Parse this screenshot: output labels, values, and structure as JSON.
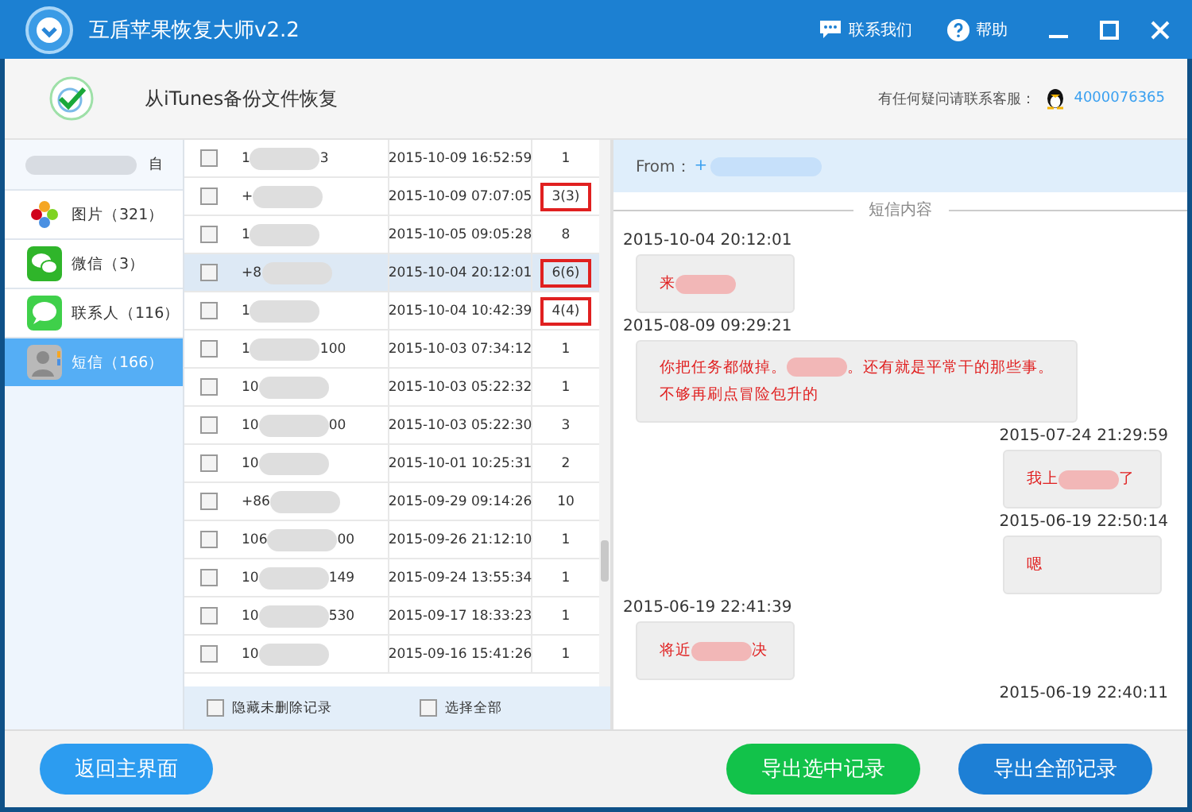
{
  "window": {
    "title": "互盾苹果恢复大师v2.2",
    "contact": "联系我们",
    "help": "帮助"
  },
  "header": {
    "title": "从iTunes备份文件恢复",
    "support_label": "有任何疑问请联系客服：",
    "support_number": "4000076365"
  },
  "sidebar": {
    "device": "自",
    "items": [
      {
        "kind": "photos",
        "label": "图片（321）",
        "selected": false
      },
      {
        "kind": "wechat",
        "label": "微信（3）",
        "selected": false
      },
      {
        "kind": "contacts",
        "label": "联系人（116）",
        "selected": false
      },
      {
        "kind": "sms",
        "label": "短信（166）",
        "selected": true
      }
    ]
  },
  "table": {
    "rows": [
      {
        "checked": false,
        "prefix": "1",
        "suffix": "3",
        "date": "2015-10-09 16:52:59",
        "count": "1",
        "selected": false,
        "flagged": false
      },
      {
        "checked": false,
        "prefix": "+",
        "date": "2015-10-09 07:07:05",
        "count": "3(3)",
        "selected": false,
        "flagged": true
      },
      {
        "checked": false,
        "prefix": "1",
        "date": "2015-10-05 09:05:28",
        "count": "8",
        "selected": false,
        "flagged": false
      },
      {
        "checked": false,
        "prefix": "+8",
        "date": "2015-10-04 20:12:01",
        "count": "6(6)",
        "selected": true,
        "flagged": true
      },
      {
        "checked": false,
        "prefix": "1",
        "date": "2015-10-04 10:42:39",
        "count": "4(4)",
        "selected": false,
        "flagged": true
      },
      {
        "checked": false,
        "prefix": "1",
        "suffix": "100",
        "date": "2015-10-03 07:34:12",
        "count": "1",
        "selected": false,
        "flagged": false
      },
      {
        "checked": false,
        "prefix": "10",
        "date": "2015-10-03 05:22:32",
        "count": "1",
        "selected": false,
        "flagged": false
      },
      {
        "checked": false,
        "prefix": "10",
        "suffix": "00",
        "date": "2015-10-03 05:22:30",
        "count": "3",
        "selected": false,
        "flagged": false
      },
      {
        "checked": false,
        "prefix": "10",
        "date": "2015-10-01 10:25:31",
        "count": "2",
        "selected": false,
        "flagged": false
      },
      {
        "checked": false,
        "prefix": "+86",
        "date": "2015-09-29 09:14:26",
        "count": "10",
        "selected": false,
        "flagged": false
      },
      {
        "checked": false,
        "prefix": "106",
        "suffix": "00",
        "date": "2015-09-26 21:12:10",
        "count": "1",
        "selected": false,
        "flagged": false
      },
      {
        "checked": false,
        "prefix": "10",
        "suffix": "149",
        "date": "2015-09-24 13:55:34",
        "count": "1",
        "selected": false,
        "flagged": false
      },
      {
        "checked": false,
        "prefix": "10",
        "suffix": "530",
        "date": "2015-09-17 18:33:23",
        "count": "1",
        "selected": false,
        "flagged": false
      },
      {
        "checked": false,
        "prefix": "10",
        "date": "2015-09-16 15:41:26",
        "count": "1",
        "selected": false,
        "flagged": false
      }
    ],
    "options": [
      {
        "label": "隐藏未删除记录",
        "checked": false
      },
      {
        "label": "选择全部",
        "checked": false
      }
    ]
  },
  "detail": {
    "from_label": "From：",
    "from_prefix": "+",
    "section_title": "短信内容",
    "messages": [
      {
        "kind": "received",
        "date": "2015-10-04 20:12:01",
        "parts": [
          {
            "kind": "text",
            "text": "来"
          },
          {
            "kind": "blur"
          }
        ]
      },
      {
        "kind": "received",
        "date": "2015-08-09 09:29:21",
        "parts": [
          {
            "kind": "text",
            "text": "你把任务都做掉。"
          },
          {
            "kind": "blur"
          },
          {
            "kind": "text",
            "text": "。还有就是平常干的那些事。"
          },
          {
            "kind": "break"
          },
          {
            "kind": "text",
            "text": "不够再刷点冒险包升的"
          }
        ]
      },
      {
        "kind": "sent",
        "date": "2015-07-24 21:29:59",
        "parts": [
          {
            "kind": "text",
            "text": "我上"
          },
          {
            "kind": "blur"
          },
          {
            "kind": "text",
            "text": "了"
          }
        ]
      },
      {
        "kind": "sent",
        "date": "2015-06-19 22:50:14",
        "parts": [
          {
            "kind": "text",
            "text": "嗯"
          }
        ]
      },
      {
        "kind": "received",
        "date": "2015-06-19 22:41:39",
        "parts": [
          {
            "kind": "text",
            "text": "将近"
          },
          {
            "kind": "blur"
          },
          {
            "kind": "text",
            "text": "决"
          }
        ]
      },
      {
        "kind": "sent",
        "date": "2015-06-19 22:40:11"
      }
    ]
  },
  "footer": {
    "back": "返回主界面",
    "export_selected": "导出选中记录",
    "export_all": "导出全部记录"
  }
}
